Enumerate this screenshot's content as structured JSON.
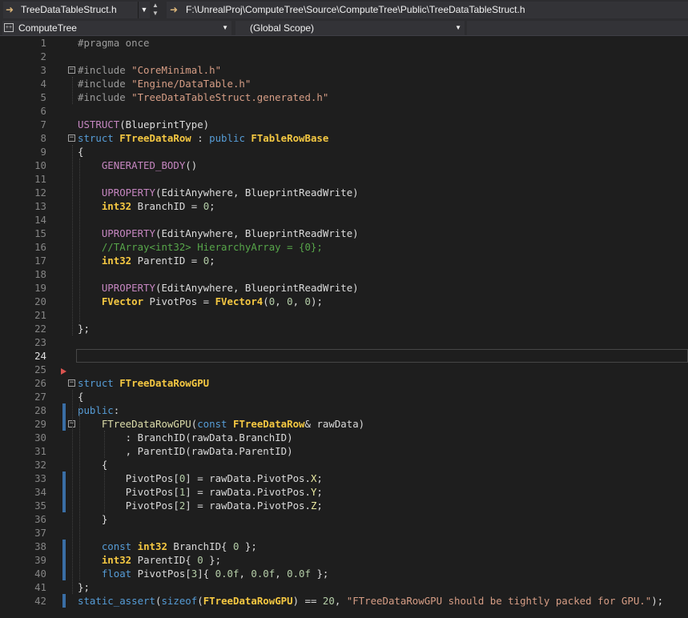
{
  "toolbar": {
    "file_tab": "TreeDataTableStruct.h",
    "file_path": "F:\\UnrealProj\\ComputeTree\\Source\\ComputeTree\\Public\\TreeDataTableStruct.h"
  },
  "navbar": {
    "project": "ComputeTree",
    "scope": "(Global Scope)"
  },
  "editor": {
    "current_line": 24,
    "lines": [
      {
        "n": "1",
        "segs": [
          [
            "p",
            "#pragma once"
          ]
        ]
      },
      {
        "n": "2",
        "segs": []
      },
      {
        "n": "3",
        "segs": [
          [
            "p",
            "#include "
          ],
          [
            "s",
            "\"CoreMinimal.h\""
          ]
        ]
      },
      {
        "n": "4",
        "segs": [
          [
            "p",
            "#include "
          ],
          [
            "s",
            "\"Engine/DataTable.h\""
          ]
        ]
      },
      {
        "n": "5",
        "segs": [
          [
            "p",
            "#include "
          ],
          [
            "s",
            "\"TreeDataTableStruct.generated.h\""
          ]
        ]
      },
      {
        "n": "6",
        "segs": []
      },
      {
        "n": "7",
        "segs": [
          [
            "m",
            "USTRUCT"
          ],
          [
            "w",
            "(BlueprintType)"
          ]
        ]
      },
      {
        "n": "8",
        "segs": [
          [
            "k",
            "struct "
          ],
          [
            "t",
            "FTreeDataRow"
          ],
          [
            "w",
            " : "
          ],
          [
            "k",
            "public "
          ],
          [
            "t",
            "FTableRowBase"
          ]
        ]
      },
      {
        "n": "9",
        "segs": [
          [
            "w",
            "{"
          ]
        ]
      },
      {
        "n": "10",
        "segs": [
          [
            "w",
            "    "
          ],
          [
            "m",
            "GENERATED_BODY"
          ],
          [
            "w",
            "()"
          ]
        ]
      },
      {
        "n": "11",
        "segs": []
      },
      {
        "n": "12",
        "segs": [
          [
            "w",
            "    "
          ],
          [
            "m",
            "UPROPERTY"
          ],
          [
            "w",
            "(EditAnywhere, BlueprintReadWrite)"
          ]
        ]
      },
      {
        "n": "13",
        "segs": [
          [
            "w",
            "    "
          ],
          [
            "t",
            "int32"
          ],
          [
            "v",
            " BranchID = "
          ],
          [
            "n",
            "0"
          ],
          [
            "w",
            ";"
          ]
        ]
      },
      {
        "n": "14",
        "segs": []
      },
      {
        "n": "15",
        "segs": [
          [
            "w",
            "    "
          ],
          [
            "m",
            "UPROPERTY"
          ],
          [
            "w",
            "(EditAnywhere, BlueprintReadWrite)"
          ]
        ]
      },
      {
        "n": "16",
        "segs": [
          [
            "w",
            "    "
          ],
          [
            "c",
            "//TArray<int32> HierarchyArray = {0};"
          ]
        ]
      },
      {
        "n": "17",
        "segs": [
          [
            "w",
            "    "
          ],
          [
            "t",
            "int32"
          ],
          [
            "v",
            " ParentID = "
          ],
          [
            "n",
            "0"
          ],
          [
            "w",
            ";"
          ]
        ]
      },
      {
        "n": "18",
        "segs": []
      },
      {
        "n": "19",
        "segs": [
          [
            "w",
            "    "
          ],
          [
            "m",
            "UPROPERTY"
          ],
          [
            "w",
            "(EditAnywhere, BlueprintReadWrite)"
          ]
        ]
      },
      {
        "n": "20",
        "segs": [
          [
            "w",
            "    "
          ],
          [
            "t",
            "FVector"
          ],
          [
            "v",
            " PivotPos = "
          ],
          [
            "t",
            "FVector4"
          ],
          [
            "w",
            "("
          ],
          [
            "n",
            "0"
          ],
          [
            "w",
            ", "
          ],
          [
            "n",
            "0"
          ],
          [
            "w",
            ", "
          ],
          [
            "n",
            "0"
          ],
          [
            "w",
            ");"
          ]
        ]
      },
      {
        "n": "21",
        "segs": []
      },
      {
        "n": "22",
        "segs": [
          [
            "w",
            "};"
          ]
        ]
      },
      {
        "n": "23",
        "segs": []
      },
      {
        "n": "24",
        "segs": []
      },
      {
        "n": "25",
        "segs": []
      },
      {
        "n": "26",
        "segs": [
          [
            "k",
            "struct "
          ],
          [
            "t",
            "FTreeDataRowGPU"
          ]
        ]
      },
      {
        "n": "27",
        "segs": [
          [
            "w",
            "{"
          ]
        ]
      },
      {
        "n": "28",
        "segs": [
          [
            "k",
            "public"
          ],
          [
            "w",
            ":"
          ]
        ]
      },
      {
        "n": "29",
        "segs": [
          [
            "w",
            "    "
          ],
          [
            "f",
            "FTreeDataRowGPU"
          ],
          [
            "w",
            "("
          ],
          [
            "k",
            "const "
          ],
          [
            "t",
            "FTreeDataRow"
          ],
          [
            "w",
            "& "
          ],
          [
            "v",
            "rawData)"
          ]
        ]
      },
      {
        "n": "30",
        "segs": [
          [
            "w",
            "        : "
          ],
          [
            "v",
            "BranchID(rawData.BranchID)"
          ]
        ]
      },
      {
        "n": "31",
        "segs": [
          [
            "w",
            "        , "
          ],
          [
            "v",
            "ParentID(rawData.ParentID)"
          ]
        ]
      },
      {
        "n": "32",
        "segs": [
          [
            "w",
            "    {"
          ]
        ]
      },
      {
        "n": "33",
        "segs": [
          [
            "w",
            "        "
          ],
          [
            "v",
            "PivotPos["
          ],
          [
            "n",
            "0"
          ],
          [
            "v",
            "] = rawData.PivotPos."
          ],
          [
            "b",
            "X"
          ],
          [
            "w",
            ";"
          ]
        ]
      },
      {
        "n": "34",
        "segs": [
          [
            "w",
            "        "
          ],
          [
            "v",
            "PivotPos["
          ],
          [
            "n",
            "1"
          ],
          [
            "v",
            "] = rawData.PivotPos."
          ],
          [
            "b",
            "Y"
          ],
          [
            "w",
            ";"
          ]
        ]
      },
      {
        "n": "35",
        "segs": [
          [
            "w",
            "        "
          ],
          [
            "v",
            "PivotPos["
          ],
          [
            "n",
            "2"
          ],
          [
            "v",
            "] = rawData.PivotPos."
          ],
          [
            "b",
            "Z"
          ],
          [
            "w",
            ";"
          ]
        ]
      },
      {
        "n": "36",
        "segs": [
          [
            "w",
            "    }"
          ]
        ]
      },
      {
        "n": "37",
        "segs": []
      },
      {
        "n": "38",
        "segs": [
          [
            "w",
            "    "
          ],
          [
            "k",
            "const "
          ],
          [
            "t",
            "int32"
          ],
          [
            "v",
            " BranchID{ "
          ],
          [
            "n",
            "0"
          ],
          [
            "w",
            " };"
          ]
        ]
      },
      {
        "n": "39",
        "segs": [
          [
            "w",
            "    "
          ],
          [
            "t",
            "int32"
          ],
          [
            "v",
            " ParentID{ "
          ],
          [
            "n",
            "0"
          ],
          [
            "w",
            " };"
          ]
        ]
      },
      {
        "n": "40",
        "segs": [
          [
            "w",
            "    "
          ],
          [
            "k",
            "float "
          ],
          [
            "v",
            "PivotPos["
          ],
          [
            "n",
            "3"
          ],
          [
            "v",
            "]{ "
          ],
          [
            "n",
            "0.0f"
          ],
          [
            "w",
            ", "
          ],
          [
            "n",
            "0.0f"
          ],
          [
            "w",
            ", "
          ],
          [
            "n",
            "0.0f"
          ],
          [
            "w",
            " };"
          ]
        ]
      },
      {
        "n": "41",
        "segs": [
          [
            "w",
            "};"
          ]
        ]
      },
      {
        "n": "42",
        "segs": [
          [
            "k",
            "static_assert"
          ],
          [
            "w",
            "("
          ],
          [
            "k",
            "sizeof"
          ],
          [
            "w",
            "("
          ],
          [
            "t",
            "FTreeDataRowGPU"
          ],
          [
            "w",
            ") == "
          ],
          [
            "n",
            "20"
          ],
          [
            "w",
            ", "
          ],
          [
            "s",
            "\"FTreeDataRowGPU should be tightly packed for GPU.\""
          ],
          [
            "w",
            ");"
          ]
        ]
      }
    ],
    "collapsible_lines": [
      3,
      8,
      26,
      29
    ],
    "changed_lines": [
      28,
      29,
      33,
      34,
      35,
      38,
      39,
      40,
      42
    ],
    "breakpoint_marker_line": 25
  }
}
